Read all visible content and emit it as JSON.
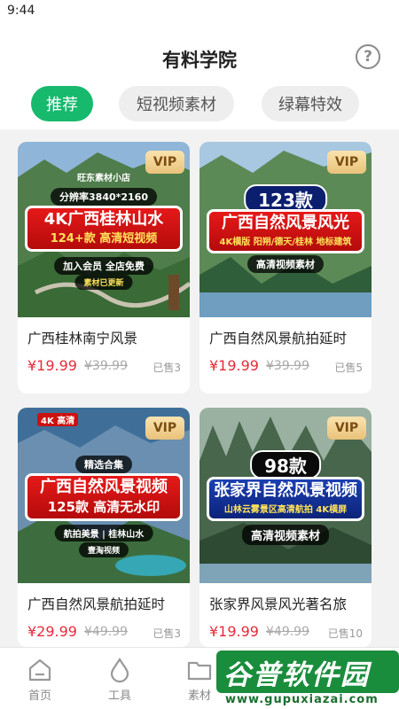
{
  "status": {
    "time": "9:44"
  },
  "header": {
    "title": "有料学院",
    "help_icon": "question-circle-icon"
  },
  "tabs": [
    {
      "label": "推荐",
      "active": true
    },
    {
      "label": "短视频素材",
      "active": false
    },
    {
      "label": "绿幕特效",
      "active": false
    }
  ],
  "products": [
    {
      "vip": "VIP",
      "thumb": {
        "top_text": "旺东素材小店",
        "pill": "分辨率3840*2160",
        "title": "4K广西桂林山水",
        "sub": "124+款 高清短视频",
        "footer": "加入会员 全店免费",
        "footer2": "素材已更新"
      },
      "name": "广西桂林南宁风景",
      "price": "¥19.99",
      "original_price": "¥39.99",
      "sold": "已售3"
    },
    {
      "vip": "VIP",
      "thumb": {
        "badge": "123款",
        "title": "广西自然风景风光",
        "sub": "4K横版 阳朔/德天/桂林 地标建筑",
        "footer": "高清视频素材"
      },
      "name": "广西自然风景航拍延时",
      "price": "¥19.99",
      "original_price": "¥39.99",
      "sold": "已售5"
    },
    {
      "vip": "VIP",
      "thumb": {
        "corner": "4K 高清",
        "pill": "精选合集",
        "title": "广西自然风景视频",
        "sub": "125款 高清无水印",
        "footer": "航拍美景 | 桂林山水",
        "footer2": "壹淘视频"
      },
      "name": "广西自然风景航拍延时",
      "price": "¥29.99",
      "original_price": "¥49.99",
      "sold": "已售3"
    },
    {
      "vip": "VIP",
      "thumb": {
        "badge": "98款",
        "title": "张家界自然风景视频",
        "sub": "山林云雾景区高清航拍 4K横屏",
        "footer": "高清视频素材"
      },
      "name": "张家界风景风光著名旅",
      "price": "¥19.99",
      "original_price": "¥49.99",
      "sold": "已售10"
    }
  ],
  "bottom_nav": [
    {
      "label": "首页",
      "icon": "home-icon"
    },
    {
      "label": "工具",
      "icon": "drop-icon"
    },
    {
      "label": "素材",
      "icon": "folder-icon"
    }
  ],
  "watermark": {
    "title": "谷普软件园",
    "url": "www.gupuxiazai.com"
  },
  "colors": {
    "accent": "#17b96c",
    "price": "#e62b3a",
    "vip_gold": "#e9c27a"
  }
}
